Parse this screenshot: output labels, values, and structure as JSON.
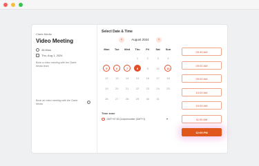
{
  "left": {
    "org": "Clarte Media",
    "title": "Video Meeting",
    "duration": "45 Mins",
    "date": "Thu, Aug 1, 2024",
    "desc1": "Book a video meeting with the Clarte Media team",
    "desc2": "Book an video meeting with the Clarte Media"
  },
  "calendar": {
    "heading": "Select Date & Time",
    "month": "August 2024",
    "weekdays": [
      "Mon",
      "Tue",
      "Wed",
      "Thu",
      "Fri",
      "Sat",
      "Sun"
    ],
    "weeks": [
      [
        "",
        "",
        "",
        "1",
        "2",
        "3",
        "4"
      ],
      [
        "5",
        "6",
        "7",
        "8",
        "9",
        "10",
        "11"
      ],
      [
        "12",
        "13",
        "14",
        "15",
        "16",
        "17",
        "18"
      ],
      [
        "19",
        "20",
        "21",
        "22",
        "23",
        "24",
        "25"
      ],
      [
        "26",
        "27",
        "28",
        "29",
        "30",
        "31",
        ""
      ]
    ],
    "available": [
      "5",
      "6",
      "7",
      "11"
    ],
    "today": "8"
  },
  "timezone": {
    "label": "Time zone",
    "value": "GMT+07:00 (Lunper/umber (GMT+1)"
  },
  "slots": [
    "09:30 AM",
    "09:00 AM",
    "09:00 AM",
    "10:00 AM",
    "10:00 AM",
    "11:00 AM",
    "12:00 PM"
  ],
  "selected_slot": "12:00 PM",
  "colors": {
    "accent": "#e24d2a",
    "selected": "#e0571c"
  }
}
